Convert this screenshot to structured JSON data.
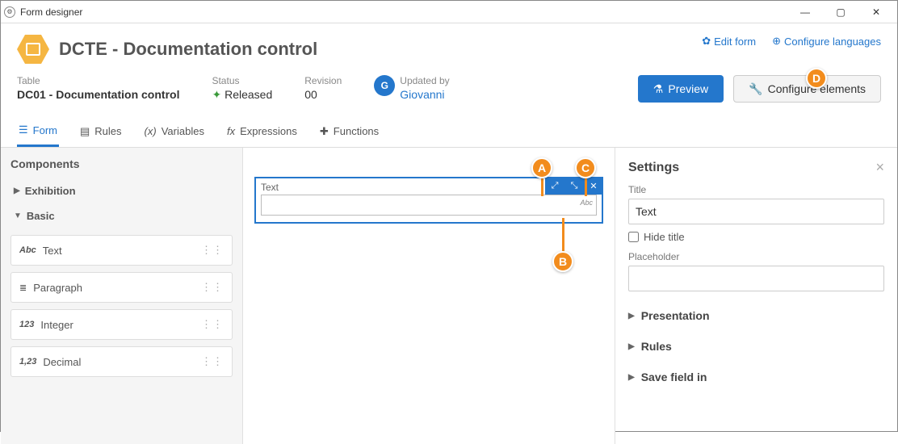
{
  "window": {
    "title": "Form designer"
  },
  "header": {
    "title": "DCTE - Documentation control",
    "edit_form": "Edit form",
    "configure_languages": "Configure languages"
  },
  "meta": {
    "table_label": "Table",
    "table_value": "DC01 - Documentation control",
    "status_label": "Status",
    "status_value": "Released",
    "revision_label": "Revision",
    "revision_value": "00",
    "updated_by_label": "Updated by",
    "updated_by_value": "Giovanni",
    "updated_by_initial": "G"
  },
  "buttons": {
    "preview": "Preview",
    "configure_elements": "Configure elements"
  },
  "tabs": {
    "form": "Form",
    "rules": "Rules",
    "variables": "Variables",
    "expressions": "Expressions",
    "functions": "Functions"
  },
  "sidebar": {
    "title": "Components",
    "groups": {
      "exhibition": "Exhibition",
      "basic": "Basic"
    },
    "items": [
      {
        "icon": "Abc",
        "label": "Text"
      },
      {
        "icon": "≣",
        "label": "Paragraph"
      },
      {
        "icon": "123",
        "label": "Integer"
      },
      {
        "icon": "1,23",
        "label": "Decimal"
      }
    ]
  },
  "canvas": {
    "field_label": "Text",
    "abc": "Abc"
  },
  "settings": {
    "title": "Settings",
    "title_label": "Title",
    "title_value": "Text",
    "hide_title": "Hide title",
    "placeholder_label": "Placeholder",
    "placeholder_value": "",
    "sections": {
      "presentation": "Presentation",
      "rules": "Rules",
      "save_field_in": "Save field in"
    }
  },
  "callouts": {
    "a": "A",
    "b": "B",
    "c": "C",
    "d": "D"
  }
}
